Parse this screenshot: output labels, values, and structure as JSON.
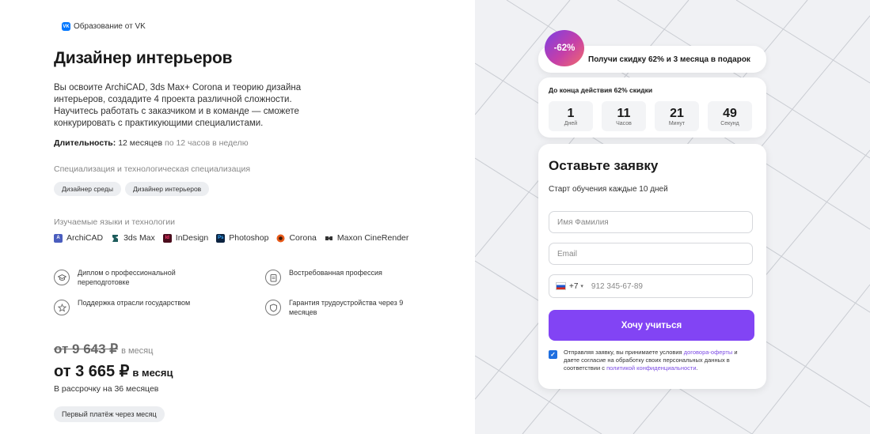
{
  "brand": {
    "logo_text": "VK",
    "label": "Образование от VK"
  },
  "course": {
    "title": "Дизайнер интерьеров",
    "description": "Вы освоите ArchiCAD, 3ds Max+ Corona и теорию дизайна интерьеров, создадите 4 проекта различной сложности. Научитесь работать с заказчиком и в команде — сможете конкурировать с практикующими специалистами.",
    "duration_label": "Длительность:",
    "duration_value": "12 месяцев",
    "duration_extra": "по 12 часов в неделю"
  },
  "specialization": {
    "label": "Специализация и технологическая специализация",
    "chips": [
      "Дизайнер среды",
      "Дизайнер интерьеров"
    ]
  },
  "technologies": {
    "label": "Изучаемые языки и технологии",
    "items": [
      {
        "name": "ArchiCAD",
        "icon": "archicad-icon",
        "icon_text": "A",
        "color": "#4a5dbe"
      },
      {
        "name": "3ds Max",
        "icon": "3dsmax-icon",
        "icon_text": "",
        "color": "#1d5c5c"
      },
      {
        "name": "InDesign",
        "icon": "indesign-icon",
        "icon_text": "Id",
        "color": "#4b0d1d"
      },
      {
        "name": "Photoshop",
        "icon": "photoshop-icon",
        "icon_text": "Ps",
        "color": "#0c2340"
      },
      {
        "name": "Corona",
        "icon": "corona-icon",
        "icon_text": "",
        "color": "#e85a1a"
      },
      {
        "name": "Maxon CineRender",
        "icon": "cinerender-icon",
        "icon_text": "",
        "color": "#333333"
      }
    ]
  },
  "features": [
    {
      "text": "Диплом о профессиональной переподготовке",
      "icon": "graduation-cap-icon"
    },
    {
      "text": "Востребованная профессия",
      "icon": "clipboard-icon"
    },
    {
      "text": "Поддержка отрасли государством",
      "icon": "star-icon"
    },
    {
      "text": "Гарантия трудоустройства через 9 месяцев",
      "icon": "shield-icon"
    }
  ],
  "pricing": {
    "old_price": "от 9 643 ₽",
    "old_unit": "в месяц",
    "new_price": "от 3 665 ₽",
    "new_unit": "в месяц",
    "installment": "В рассрочку на 36 месяцев",
    "first_payment": "Первый платёж через месяц"
  },
  "promo": {
    "badge": "-62%",
    "text": "Получи скидку 62% и 3 месяца в подарок"
  },
  "timer": {
    "title": "До конца действия 62% скидки",
    "units": [
      {
        "value": "1",
        "label": "Дней"
      },
      {
        "value": "11",
        "label": "Часов"
      },
      {
        "value": "21",
        "label": "Минут"
      },
      {
        "value": "49",
        "label": "Секунд"
      }
    ]
  },
  "form": {
    "title": "Оставьте заявку",
    "subtitle": "Старт обучения каждые 10 дней",
    "name_placeholder": "Имя Фамилия",
    "email_placeholder": "Email",
    "phone_code": "+7",
    "phone_placeholder": "912 345-67-89",
    "submit_label": "Хочу учиться",
    "consent_part1": "Отправляя заявку, вы принимаете условия",
    "consent_link1": "договора-оферты",
    "consent_part2": "и даете согласие на обработку своих персональных данных в соответствии с",
    "consent_link2": "политикой конфиденциальности",
    "consent_end": "."
  },
  "colors": {
    "accent": "#8244f4",
    "badge_gradient": [
      "#7b3fe4",
      "#c53fa8",
      "#f26b6b"
    ],
    "checkbox": "#1f6fe0",
    "link": "#7c4be4"
  }
}
